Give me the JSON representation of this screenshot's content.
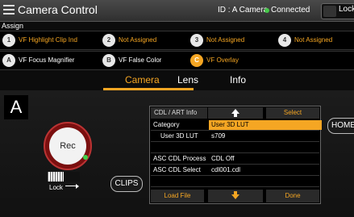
{
  "header": {
    "title": "Camera Control",
    "camera_id": "ID : A Camera",
    "connection_status": "Connected",
    "connection_color": "#46c84a",
    "lock_label": "Lock"
  },
  "assign": {
    "label": "Assign",
    "row1": [
      {
        "num": "1",
        "label": "VF Highlight Clip Ind"
      },
      {
        "num": "2",
        "label": "Not Assigned"
      },
      {
        "num": "3",
        "label": "Not Assigned"
      },
      {
        "num": "4",
        "label": "Not Assigned"
      }
    ],
    "row2": [
      {
        "num": "A",
        "label": "VF Focus Magnifier"
      },
      {
        "num": "B",
        "label": "VF False Color"
      },
      {
        "num": "C",
        "label": "VF Overlay"
      }
    ]
  },
  "tabs": [
    {
      "label": "Camera",
      "active": true
    },
    {
      "label": "Lens",
      "active": false
    },
    {
      "label": "Info",
      "active": false
    }
  ],
  "left": {
    "camera_letter": "A",
    "rec_label": "Rec",
    "lock_label": "Lock",
    "clips_label": "CLIPS"
  },
  "panel": {
    "title": "CDL / ART Info",
    "select_label": "Select",
    "rows": [
      {
        "key": "Category",
        "value": "User 3D LUT",
        "selected": true
      },
      {
        "key": "User 3D LUT",
        "value": "s709",
        "selected": false
      },
      {
        "key": "",
        "value": "",
        "selected": false
      },
      {
        "key": "ASC CDL Process",
        "value": "CDL Off",
        "selected": false
      },
      {
        "key": "ASC CDL Select",
        "value": "cdl001.cdl",
        "selected": false
      },
      {
        "key": "",
        "value": "",
        "selected": false
      }
    ],
    "load_label": "Load File",
    "done_label": "Done"
  },
  "home_label": "HOME",
  "accent_color": "#f5a623"
}
